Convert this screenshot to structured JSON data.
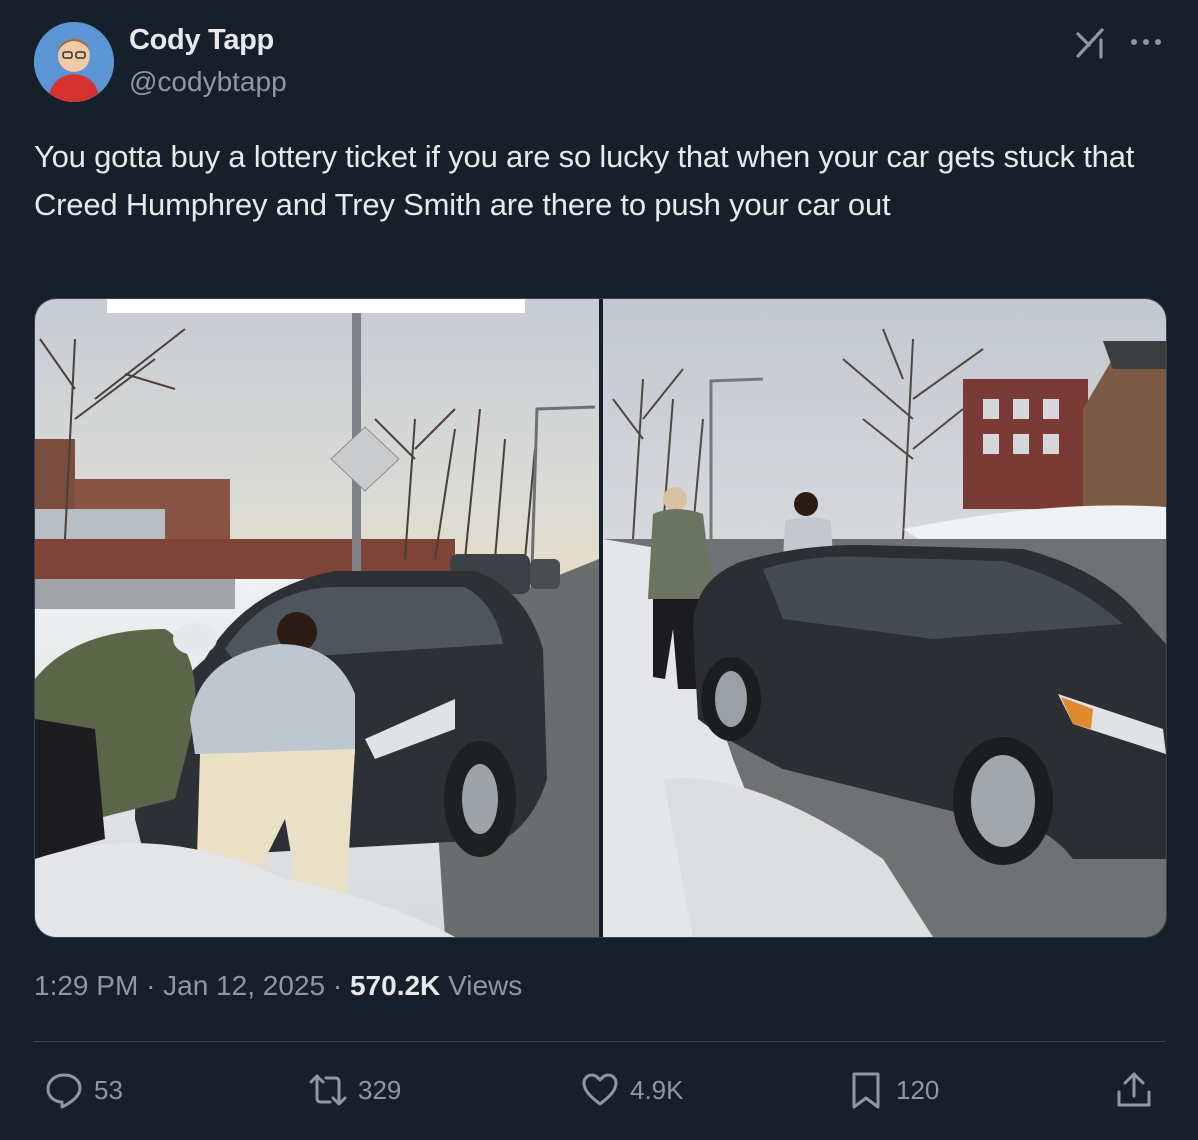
{
  "author": {
    "name": "Cody Tapp",
    "handle": "@codybtapp"
  },
  "tweet": {
    "text": "You gotta buy a lottery ticket if you are so lucky that when your car gets stuck that Creed Humphrey and Trey Smith are there to push your car out"
  },
  "meta": {
    "time": "1:29 PM",
    "date": "Jan 12, 2025",
    "views_count": "570.2K",
    "views_label": "Views",
    "separator": "·"
  },
  "actions": {
    "replies": "53",
    "reposts": "329",
    "likes": "4.9K",
    "bookmarks": "120"
  },
  "colors": {
    "background": "#15202b",
    "text": "#e7e9ea",
    "secondary": "#8b98a5",
    "border": "#38444d"
  },
  "icons": [
    "grok-icon",
    "more-icon",
    "reply-icon",
    "repost-icon",
    "like-icon",
    "bookmark-icon",
    "share-icon"
  ]
}
